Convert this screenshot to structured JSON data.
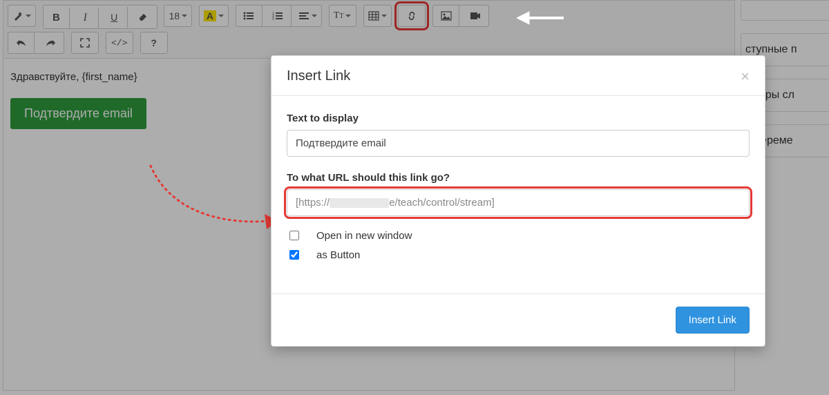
{
  "sidebar": [
    "",
    "ступные п",
    "имеры сл",
    "и переме"
  ],
  "editor": {
    "greeting": "Здравствуйте, {first_name}",
    "confirm_button": "Подтвердите email",
    "font_size_label": "18"
  },
  "modal": {
    "title": "Insert Link",
    "text_to_display_label": "Text to display",
    "text_to_display_value": "Подтвердите email",
    "url_label": "To what URL should this link go?",
    "url_value_prefix": "[https://",
    "url_value_suffix": "e/teach/control/stream]",
    "open_new_window_label": "Open in new window",
    "open_new_window_checked": false,
    "as_button_label": "as Button",
    "as_button_checked": true,
    "submit_label": "Insert Link"
  },
  "colors": {
    "accent_red": "#e53935",
    "primary_blue": "#2f93e0",
    "confirm_green": "#2e9c3d",
    "highlighter_yellow": "#ffe600"
  }
}
